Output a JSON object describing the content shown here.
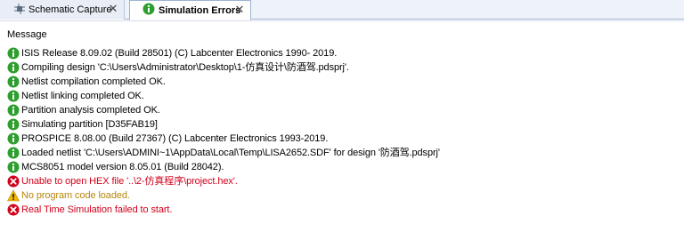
{
  "tabs": [
    {
      "label": "Schematic Capture",
      "icon": "schematic-icon",
      "active": false
    },
    {
      "label": "Simulation Errors",
      "icon": "info-icon",
      "active": true
    }
  ],
  "column_header": "Message",
  "messages": [
    {
      "type": "info",
      "icon": "info-icon",
      "text": "ISIS Release 8.09.02 (Build 28501) (C) Labcenter Electronics 1990- 2019."
    },
    {
      "type": "info",
      "icon": "info-icon",
      "text": "Compiling design 'C:\\Users\\Administrator\\Desktop\\1-仿真设计\\防酒驾.pdsprj'."
    },
    {
      "type": "info",
      "icon": "info-icon",
      "text": "Netlist compilation completed OK."
    },
    {
      "type": "info",
      "icon": "info-icon",
      "text": "Netlist linking completed OK."
    },
    {
      "type": "info",
      "icon": "info-icon",
      "text": "Partition analysis completed OK."
    },
    {
      "type": "info",
      "icon": "info-icon",
      "text": "Simulating partition [D35FAB19]"
    },
    {
      "type": "info",
      "icon": "info-icon",
      "text": "PROSPICE 8.08.00 (Build 27367) (C) Labcenter Electronics 1993-2019."
    },
    {
      "type": "info",
      "icon": "info-icon",
      "text": "Loaded netlist 'C:\\Users\\ADMINI~1\\AppData\\Local\\Temp\\LISA2652.SDF' for design '防酒驾.pdsprj'"
    },
    {
      "type": "info",
      "icon": "info-icon",
      "text": "MCS8051 model version 8.05.01 (Build 28042)."
    },
    {
      "type": "error",
      "icon": "error-icon",
      "text": "Unable to open HEX file '..\\2-仿真程序\\project.hex'."
    },
    {
      "type": "warning",
      "icon": "warning-icon",
      "text": "No program code loaded."
    },
    {
      "type": "error",
      "icon": "error-icon",
      "text": "Real Time Simulation failed to start."
    }
  ],
  "colors": {
    "info": "#2e9e2e",
    "error": "#d0021b",
    "warning": "#f2b800",
    "tab_border": "#9db3d1"
  }
}
